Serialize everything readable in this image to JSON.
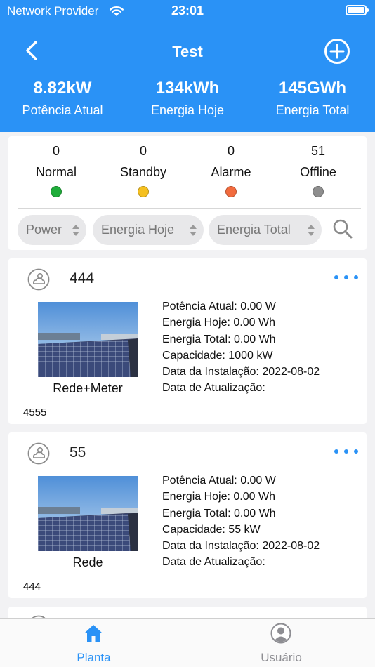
{
  "status_bar": {
    "carrier": "Network Provider",
    "time": "23:01"
  },
  "nav": {
    "title": "Test"
  },
  "stats": [
    {
      "value": "8.82kW",
      "label": "Potência Atual"
    },
    {
      "value": "134kWh",
      "label": "Energia Hoje"
    },
    {
      "value": "145GWh",
      "label": "Energia Total"
    }
  ],
  "status_summary": [
    {
      "count": "0",
      "label": "Normal",
      "color": "#1fad3a"
    },
    {
      "count": "0",
      "label": "Standby",
      "color": "#f5c020"
    },
    {
      "count": "0",
      "label": "Alarme",
      "color": "#f26b3e"
    },
    {
      "count": "51",
      "label": "Offline",
      "color": "#8e8e8e"
    }
  ],
  "sort_chips": [
    "Power",
    "Energia Hoje",
    "Energia Total"
  ],
  "plants": [
    {
      "name": "444",
      "type": "Rede+Meter",
      "code": "4555",
      "details": [
        "Potência Atual: 0.00 W",
        "Energia Hoje: 0.00 Wh",
        "Energia Total: 0.00 Wh",
        "Capacidade: 1000 kW",
        "Data da Instalação: 2022-08-02",
        "Data de Atualização:"
      ]
    },
    {
      "name": "55",
      "type": "Rede",
      "code": "444",
      "details": [
        "Potência Atual: 0.00 W",
        "Energia Hoje: 0.00 Wh",
        "Energia Total: 0.00 Wh",
        "Capacidade: 55 kW",
        "Data da Instalação: 2022-08-02",
        "Data de Atualização:"
      ]
    }
  ],
  "tabs": [
    {
      "label": "Planta",
      "icon": "home-icon",
      "active": true
    },
    {
      "label": "Usuário",
      "icon": "user-icon",
      "active": false
    }
  ],
  "colors": {
    "accent": "#2a92f6",
    "background": "#f2f2f4"
  }
}
